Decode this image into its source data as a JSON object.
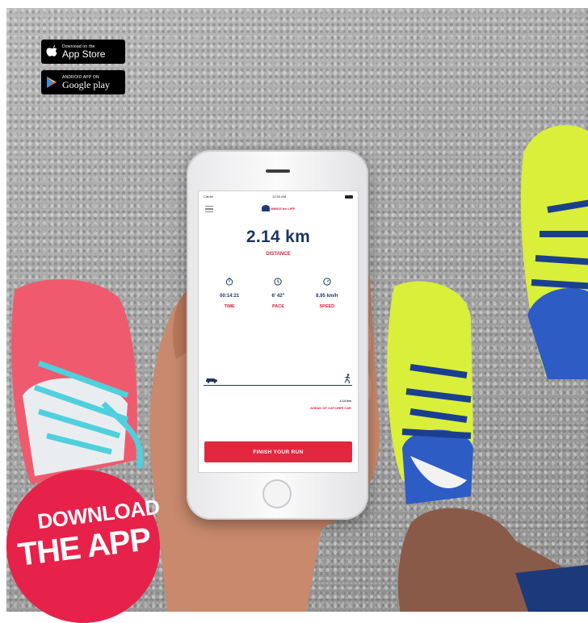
{
  "badges": {
    "app_store": {
      "small": "Download on the",
      "big": "App Store",
      "icon": "apple-icon"
    },
    "google_play": {
      "small": "ANDROID APP ON",
      "big": "Google play",
      "icon": "play-triangle-icon"
    }
  },
  "phone": {
    "status": {
      "carrier": "Carrier",
      "time": "12:00 AM"
    },
    "logo": "WINGS for LIFE",
    "distance": {
      "value": "2.14 km",
      "label": "DISTANCE"
    },
    "stats": [
      {
        "icon": "stopwatch-icon",
        "value": "00:14:21",
        "label": "TIME"
      },
      {
        "icon": "clock-icon",
        "value": "6' 42\"",
        "label": "PACE"
      },
      {
        "icon": "speedometer-icon",
        "value": "8.95 km/h",
        "label": "SPEED"
      }
    ],
    "tracker": {
      "distance_ahead": "2.14 km",
      "label": "AHEAD OF CATCHER CAR"
    },
    "finish_button": "FINISH YOUR RUN"
  },
  "download": {
    "line1": "DOWNLOAD",
    "line2": "THE APP"
  },
  "colors": {
    "accent_red": "#e3273f",
    "navy": "#1f3560",
    "badge_pink": "#e6224a",
    "shoe_pink": "#f05a6e",
    "shoe_yellow": "#d9ef3a",
    "lace_blue": "#1b3f8f"
  }
}
